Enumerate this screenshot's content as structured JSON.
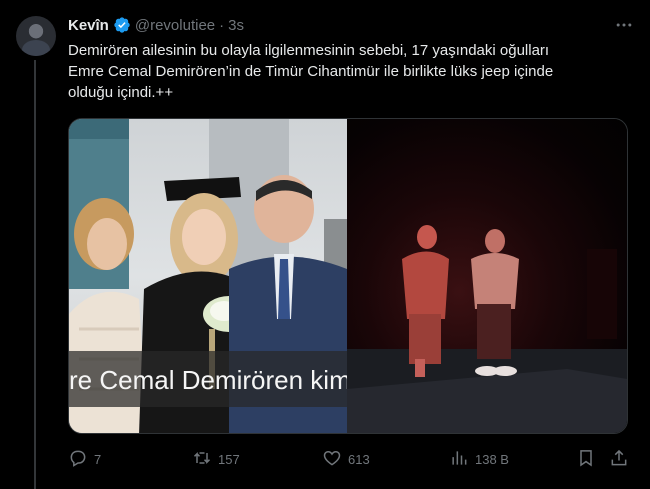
{
  "author": {
    "name": "Kevîn",
    "handle": "@revolutiee",
    "separator": "·",
    "time": "3s"
  },
  "tweet": {
    "lines": [
      "Demirören ailesinin bu olayla ilgilenmesinin sebebi, 17 yaşındaki oğulları",
      "Emre Cemal Demirören’in de Timür Cihantimür ile birlikte lüks jeep içinde",
      "olduğu içindi.++"
    ]
  },
  "media": {
    "caption": "re Cemal Demirören kimc"
  },
  "actions": {
    "replies": "7",
    "reposts": "157",
    "likes": "613",
    "views": "138 B"
  },
  "colors": {
    "background": "#000000",
    "text": "#e7e9ea",
    "muted": "#71767b",
    "verified": "#1d9bf0",
    "border": "#2f3336"
  },
  "icons": [
    "verified-badge-icon",
    "more-icon",
    "reply-icon",
    "retweet-icon",
    "like-icon",
    "views-icon",
    "bookmark-icon",
    "share-icon"
  ]
}
